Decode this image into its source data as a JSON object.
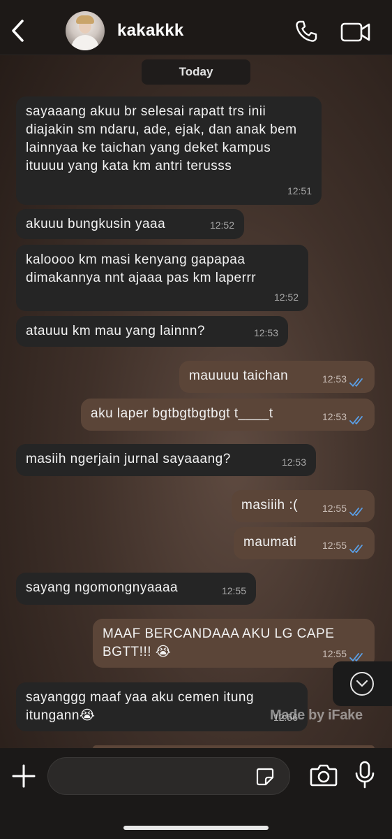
{
  "header": {
    "contact_name": "kakakkk",
    "icons": [
      "back-icon",
      "avatar",
      "phone-icon",
      "video-icon"
    ]
  },
  "date_separator": "Today",
  "messages": [
    {
      "dir": "in",
      "text": "sayaaang akuu br selesai rapatt trs inii diajakin sm ndaru, ade, ejak, dan anak bem lainnyaa ke taichan yang deket kampus ituuuu yang kata km antri terusss",
      "time": "12:51"
    },
    {
      "dir": "in",
      "text": "akuuu bungkusin yaaa",
      "time": "12:52"
    },
    {
      "dir": "in",
      "text": "kaloooo km masi kenyang gapapaa dimakannya nnt ajaaa pas km laperrr",
      "time": "12:52"
    },
    {
      "dir": "in",
      "text": "atauuu km mau yang lainnn?",
      "time": "12:53"
    },
    {
      "dir": "out",
      "text": "mauuuu taichan",
      "time": "12:53"
    },
    {
      "dir": "out",
      "text": "aku laper bgtbgtbgtbgt t____t",
      "time": "12:53"
    },
    {
      "dir": "in",
      "text": "masiih ngerjain jurnal sayaaang?",
      "time": "12:53"
    },
    {
      "dir": "out",
      "text": "masiiih :(",
      "time": "12:55"
    },
    {
      "dir": "out",
      "text": "maumati",
      "time": "12:55"
    },
    {
      "dir": "in",
      "text": "sayang ngomongnyaaaa",
      "time": "12:55"
    },
    {
      "dir": "out",
      "text": "MAAF BERCANDAAA AKU LG CAPE BGTT!!! 😭",
      "time": "12:55"
    },
    {
      "dir": "in",
      "text": "sayanggg maaf yaa aku cemen itung itungann😭",
      "time": "12:56"
    }
  ],
  "watermark": "Made by iFake",
  "input": {
    "placeholder": "",
    "value": ""
  },
  "colors": {
    "incoming_bubble": "#252525",
    "outgoing_bubble": "#5b4538",
    "read_ticks": "#5aa0e8",
    "bar_background": "#1d1917"
  }
}
